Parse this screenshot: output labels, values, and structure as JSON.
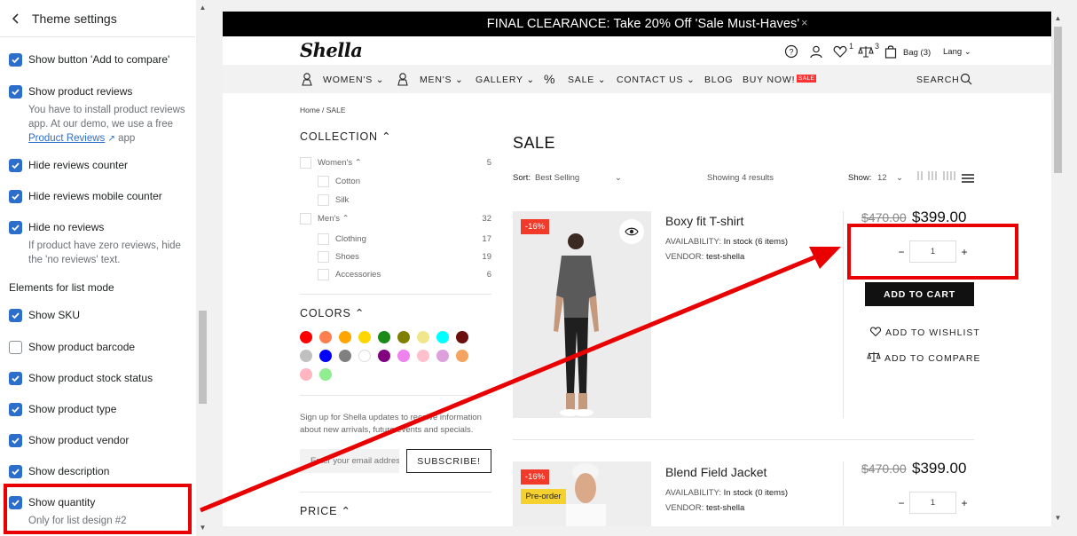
{
  "left_panel": {
    "title": "Theme settings",
    "settings": [
      {
        "label": "Show button 'Add to compare'",
        "checked": true
      },
      {
        "label": "Show product reviews",
        "checked": true,
        "help_before": "You have to install product reviews app. At our demo, we use a free ",
        "help_link": "Product Reviews",
        "help_after": " app"
      },
      {
        "label": "Hide reviews counter",
        "checked": true
      },
      {
        "label": "Hide reviews mobile counter",
        "checked": true
      },
      {
        "label": "Hide no reviews",
        "checked": true,
        "help": "If product have zero reviews, hide the 'no reviews' text."
      },
      {
        "label": "Show SKU",
        "checked": true
      },
      {
        "label": "Show product barcode",
        "checked": false
      },
      {
        "label": "Show product stock status",
        "checked": true
      },
      {
        "label": "Show product type",
        "checked": true
      },
      {
        "label": "Show product vendor",
        "checked": true
      },
      {
        "label": "Show description",
        "checked": true
      },
      {
        "label": "Show quantity",
        "checked": true,
        "help": "Only for list design #2"
      }
    ],
    "section_list_mode": "Elements for list mode"
  },
  "store": {
    "announcement": "FINAL CLEARANCE: Take 20% Off 'Sale Must-Haves'",
    "announcement_close": "×",
    "logo": "Shella",
    "wishlist_count": "1",
    "compare_count": "3",
    "bag_label": "Bag (3)",
    "lang_label": "Lang ⌄",
    "nav": {
      "womens": "WOMEN'S ⌄",
      "mens": "MEN'S ⌄",
      "gallery": "GALLERY ⌄",
      "sale": "SALE ⌄",
      "contact": "CONTACT US ⌄",
      "blog": "BLOG",
      "buy_now": "BUY NOW!",
      "sale_badge": "SALE",
      "search": "SEARCH"
    },
    "breadcrumb": "Home  /  SALE",
    "filters": {
      "collection_title": "COLLECTION ⌃",
      "items": [
        {
          "label": "Women's ⌃",
          "count": "5"
        },
        {
          "label": "Cotton",
          "count": ""
        },
        {
          "label": "Silk",
          "count": ""
        },
        {
          "label": "Men's ⌃",
          "count": "32"
        },
        {
          "label": "Clothing",
          "count": "17"
        },
        {
          "label": "Shoes",
          "count": "19"
        },
        {
          "label": "Accessories",
          "count": "6"
        }
      ],
      "colors_title": "COLORS ⌃",
      "colors": [
        "#ff0000",
        "#ff7f50",
        "#ffa500",
        "#ffd700",
        "#1a8a1a",
        "#808000",
        "#f0e68c",
        "#00ffff",
        "#6b0e0e",
        "#c0c0c0",
        "#0000ff",
        "#808080",
        "#ffffff",
        "#800080",
        "#ee82ee",
        "#ffc0cb",
        "#dda0dd",
        "#f4a460",
        "#ffb6c1",
        "#90ee90"
      ],
      "newsletter_text": "Sign up for Shella updates to receive information about new arrivals, future events and specials.",
      "email_placeholder": "Enter your email address",
      "subscribe": "SUBSCRIBE!",
      "price_title": "PRICE ⌃"
    },
    "listing": {
      "title": "SALE",
      "sort_label": "Sort:",
      "sort_value": "Best Selling",
      "showing": "Showing 4 results",
      "show_label": "Show:",
      "show_value": "12"
    },
    "products": [
      {
        "name": "Boxy fit T-shirt",
        "badge": "-16%",
        "availability_label": "AVAILABILITY:",
        "availability": "In stock (6 items)",
        "vendor_label": "VENDOR:",
        "vendor": "test-shella",
        "old_price": "$470.00",
        "price": "$399.00",
        "qty": "1",
        "add_to_cart": "ADD TO CART",
        "wishlist": "ADD TO WISHLIST",
        "compare": "ADD TO COMPARE"
      },
      {
        "name": "Blend Field Jacket",
        "badge": "-16%",
        "badge2": "Pre-order",
        "availability_label": "AVAILABILITY:",
        "availability": "In stock (0 items)",
        "vendor_label": "VENDOR:",
        "vendor": "test-shella",
        "old_price": "$470.00",
        "price": "$399.00",
        "qty": "1"
      }
    ],
    "qty_minus": "−",
    "qty_plus": "+"
  },
  "colors": {
    "accent": "#2c6ecb",
    "highlight": "#e90000"
  }
}
